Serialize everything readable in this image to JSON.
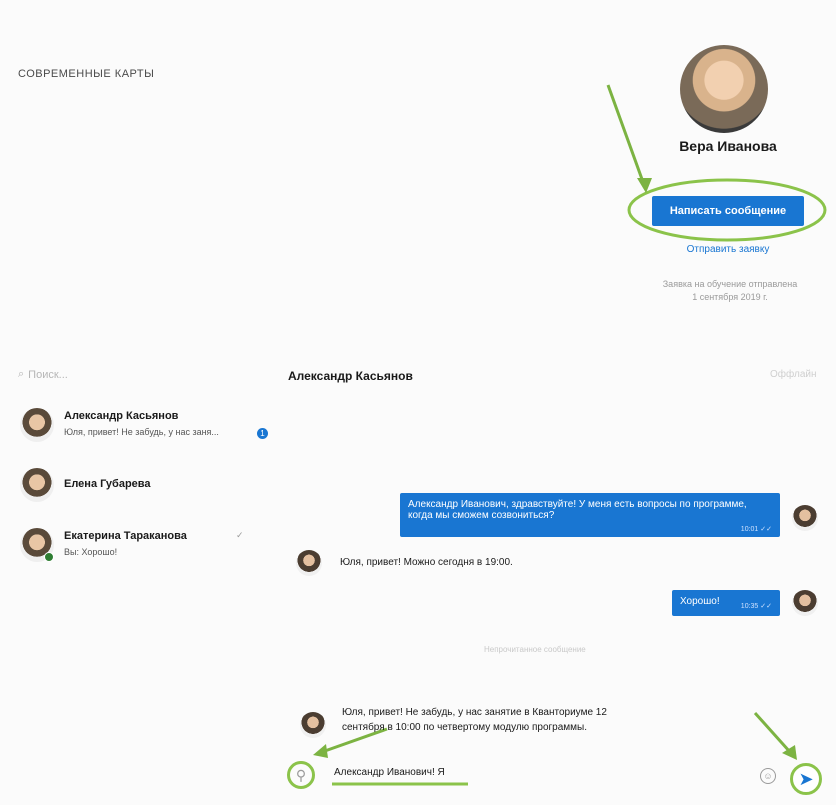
{
  "top": {
    "faded_header": "",
    "section_title": "СОВРЕМЕННЫЕ КАРТЫ",
    "card_rows": [
      "",
      "",
      "",
      ""
    ]
  },
  "profile": {
    "name": "Вера Иванова",
    "subtitle": "",
    "write_button": "Написать сообщение",
    "send_request": "Отправить заявку",
    "request_note_line1": "Заявка на обучение отправлена",
    "request_note_line2": "1 сентября 2019 г."
  },
  "search": {
    "placeholder": "Поиск..."
  },
  "contacts": [
    {
      "name": "Александр Касьянов",
      "message": "Юля, привет! Не забудь, у нас заня...",
      "badge": "1"
    },
    {
      "name": "Елена Губарева",
      "message": ""
    },
    {
      "name": "Екатерина Тараканова",
      "message": "Вы: Хорошо!",
      "check": "✓"
    }
  ],
  "chat": {
    "title": "Александр Касьянов",
    "status": "Оффлайн",
    "date_separator": "",
    "unread_separator": "Непрочитанное сообщение",
    "messages": [
      {
        "direction": "out",
        "text": "Александр Иванович, здравствуйте! У меня есть вопросы по программе, когда мы сможем созвониться?",
        "time": "10:01 ✓✓"
      },
      {
        "direction": "in",
        "text": "Юля, привет! Можно сегодня в 19:00."
      },
      {
        "direction": "out",
        "text": "Хорошо!",
        "time": "10:35 ✓✓"
      },
      {
        "direction": "in",
        "text_line1": "Юля, привет! Не забудь, у нас занятие в Кванториуме 12",
        "text_line2": "сентября в 10:00 по четвертому модулю программы."
      }
    ],
    "input_value": "Александр Иванович! Я"
  },
  "icons": {
    "attach": "paperclip-icon",
    "emoji": "smiley-icon",
    "send": "send-arrow-icon",
    "search": "search-icon"
  },
  "colors": {
    "accent": "#1976d2",
    "highlight": "#8bc34a"
  }
}
